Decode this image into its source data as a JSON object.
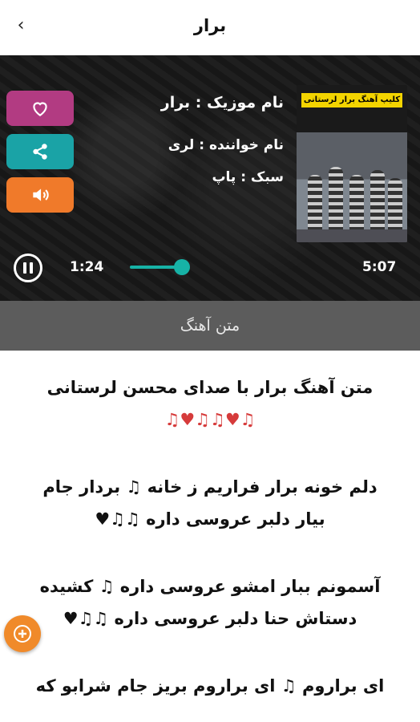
{
  "header": {
    "title": "برار",
    "back_icon": "chevron-left-icon"
  },
  "player": {
    "music_name": "نام موزیک : برار",
    "singer_name": "نام خواننده : لری",
    "genre": "سبک : پاپ",
    "current_time": "1:24",
    "duration": "5:07",
    "progress_fraction": 0.27,
    "cover_banner_text": "کلیپ آهنگ برار لرستانی",
    "actions": [
      {
        "icon": "heart-icon",
        "color": "#b23b82"
      },
      {
        "icon": "share-icon",
        "color": "#1aa3a6"
      },
      {
        "icon": "volume-icon",
        "color": "#f07a2a"
      }
    ],
    "accent_color": "#17b2a6"
  },
  "lyrics_tab": {
    "label": "متن آهنگ"
  },
  "lyrics": {
    "lines": [
      "متن آهنگ برار با صدای محسن لرستانی",
      "♫♥♫♫♥♫",
      "",
      "دلم خونه برار فراریم ز خانه ♫ بردار جام",
      "بیار دلبر عروسی داره ♫♫♥",
      "",
      "آسمونم ببار امشو عروسی داره ♫ کشیده",
      "دستاش حنا دلبر عروسی داره ♫♫♥",
      "",
      "ای براروم ♫ ای براروم بریز جام شرابو که"
    ]
  },
  "fab": {
    "icon": "plus-icon",
    "color": "#f08a2a"
  }
}
